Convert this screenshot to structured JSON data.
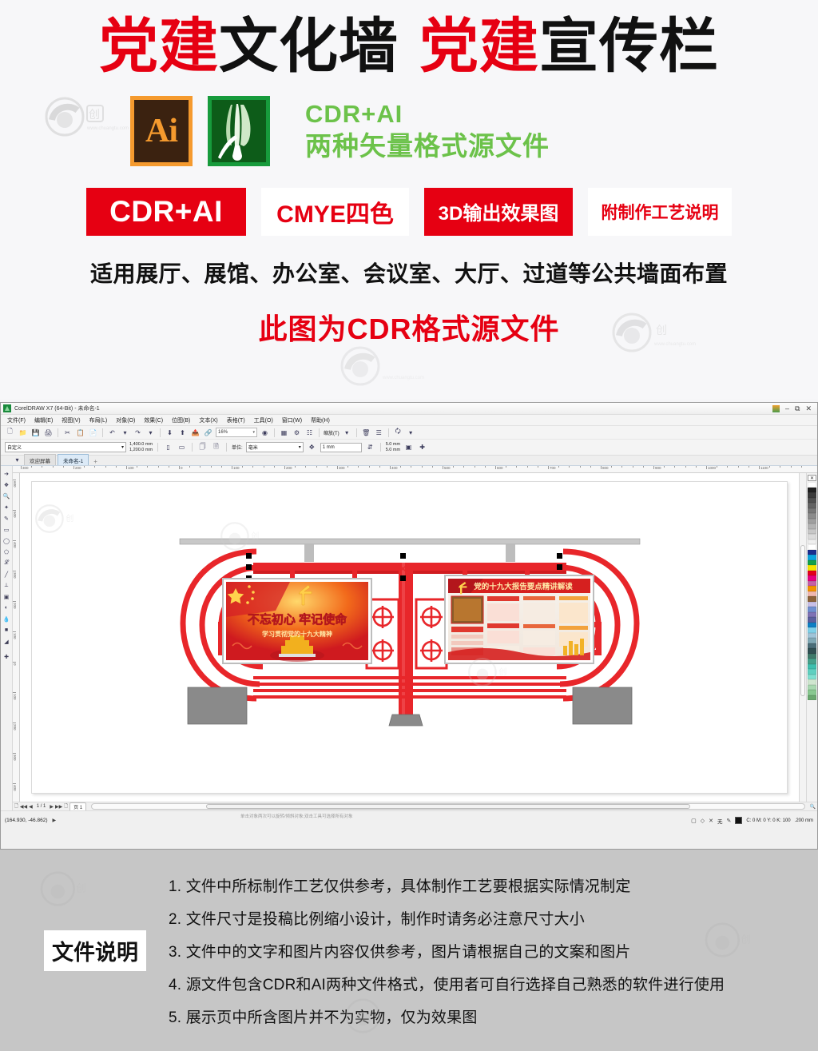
{
  "promo": {
    "title_parts": [
      {
        "text": "党建",
        "color": "red"
      },
      {
        "text": "文化墙",
        "color": "black"
      },
      {
        "text": "党建",
        "color": "red"
      },
      {
        "text": "宣传栏",
        "color": "black"
      }
    ],
    "ai_badge_label": "Ai",
    "cdr_badge_label": "CorelDRAW",
    "logo_line1": "CDR+AI",
    "logo_line2": "两种矢量格式源文件",
    "tags": [
      {
        "label": "CDR+AI",
        "style": "filled"
      },
      {
        "label": "CMYE四色",
        "style": "outline"
      },
      {
        "label": "3D输出效果图",
        "style": "filled"
      },
      {
        "label": "附制作工艺说明",
        "style": "outline"
      }
    ],
    "subline": "适用展厅、展馆、办公室、会议室、大厅、过道等公共墙面布置",
    "redline": "此图为CDR格式源文件",
    "colors": {
      "red": "#e60012",
      "green": "#6cc24a",
      "black": "#111111"
    }
  },
  "app": {
    "window_title": "CorelDRAW X7 (64-Bit) - 未命名-1",
    "window_controls": [
      "最小化",
      "还原",
      "关闭"
    ],
    "menus": [
      "文件(F)",
      "编辑(E)",
      "视图(V)",
      "布局(L)",
      "对象(O)",
      "效果(C)",
      "位图(B)",
      "文本(X)",
      "表格(T)",
      "工具(O)",
      "窗口(W)",
      "帮助(H)"
    ],
    "toolbar": {
      "buttons": [
        "新建",
        "打开",
        "保存",
        "打印",
        "剪切",
        "复制",
        "粘贴",
        "撤销",
        "重做",
        "导入",
        "导出",
        "发布为PDF",
        "启动",
        "应用程序"
      ],
      "zoom_level": "16%",
      "quality_label": "缩放(T)"
    },
    "propbar": {
      "page_preset": "自定义",
      "width": "1,400.0 mm",
      "height": "1,200.0 mm",
      "unit_label": "单位:",
      "unit_value": "毫米",
      "nudge": "1 mm",
      "bleed_h": "5.0 mm",
      "bleed_v": "5.0 mm"
    },
    "tabs": [
      {
        "label": "欢迎屏幕",
        "active": false
      },
      {
        "label": "未命名-1",
        "active": true
      }
    ],
    "toolbox": [
      "选择工具",
      "形状工具",
      "缩放工具",
      "手绘工具",
      "艺术笔工具",
      "矩形工具",
      "椭圆形工具",
      "多边形工具",
      "文本工具",
      "平行度量工具",
      "直线连接器",
      "阴影工具",
      "透明度工具",
      "颜色滴管",
      "交互式填充",
      "智能填充"
    ],
    "ruler_h_labels": [
      "300",
      "200",
      "100",
      "0",
      "100",
      "200",
      "300",
      "400",
      "500",
      "600",
      "700",
      "800",
      "900",
      "1000",
      "1100"
    ],
    "ruler_v_labels": [
      "600",
      "500",
      "400",
      "300",
      "200",
      "100",
      "0",
      "100",
      "200",
      "300",
      "400"
    ],
    "pagenav": {
      "page_indicator": "1 / 1",
      "page_tab": "页 1"
    },
    "statusbar": {
      "coordinates": "(164.930, -46.862)",
      "hint": "单击对象两次可以旋转/倾斜对象;双击工具可选择所有对象",
      "fill_none": "无",
      "outline_color": "C: 0 M: 0 Y: 0 K: 100",
      "outline_width": ".200 mm"
    },
    "palette_colors": [
      "#ffffff",
      "#1f1f1f",
      "#3a3a3a",
      "#4f4f4f",
      "#636363",
      "#777777",
      "#8b8b8b",
      "#9f9f9f",
      "#b3b3b3",
      "#c7c7c7",
      "#dbdbdb",
      "#efefef",
      "#ffffff",
      "#1a2d8f",
      "#0aa3dd",
      "#12a04a",
      "#f2e400",
      "#e3001b",
      "#e6007e",
      "#c45fa8",
      "#f29100",
      "#f0b8b0",
      "#8c6239",
      "#c8bfe7",
      "#6f8fd0",
      "#7e72b5",
      "#5a5f9e",
      "#0d7fc4",
      "#7fd0e8",
      "#9fc4d8",
      "#7fa8b5",
      "#4a6d78",
      "#2f4f52",
      "#3f7a6a",
      "#46a08a",
      "#3fbfae",
      "#5fd0c0",
      "#7fe0d0",
      "#cfe6cf",
      "#a8d8b0",
      "#88c890",
      "#6aa86f"
    ],
    "artwork": {
      "left_board_title": "不忘初心  牢记使命",
      "left_board_subtitle": "学习贯彻党的十九大精神",
      "right_board_title": "党的十九大报告要点精讲解读",
      "frame_color": "#e8262a",
      "base_color": "#808080"
    }
  },
  "footer": {
    "label": "文件说明",
    "items": [
      "1. 文件中所标制作工艺仅供参考，具体制作工艺要根据实际情况制定",
      "2. 文件尺寸是投稿比例缩小设计，制作时请务必注意尺寸大小",
      "3. 文件中的文字和图片内容仅供参考，图片请根据自己的文案和图片",
      "4. 源文件包含CDR和AI两种文件格式，使用者可自行选择自己熟悉的软件进行使用",
      "5. 展示页中所含图片并不为实物，仅为效果图"
    ]
  },
  "watermark": {
    "text": "创图网",
    "url": "www.chuangtu.com"
  }
}
